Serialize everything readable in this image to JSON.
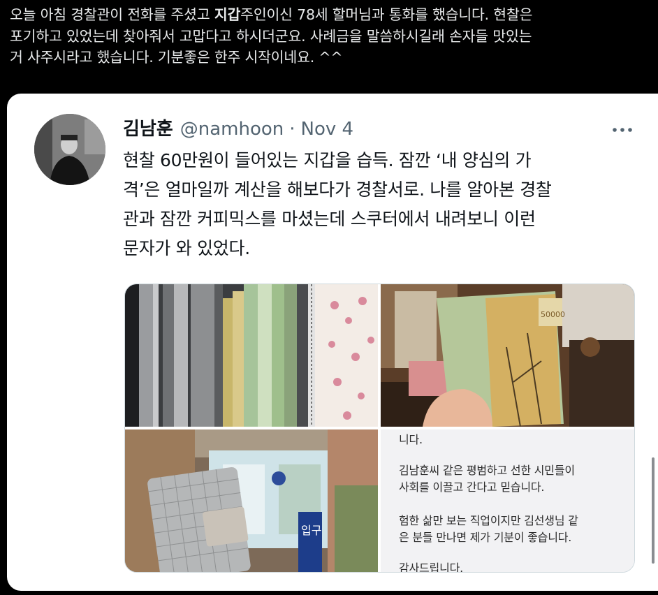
{
  "intro": {
    "line1_a": "오늘 아침 경찰관이 전화를 주셨고 ",
    "line1_bold": "지갑",
    "line1_b": "주인이신 78세 할머님과 통화를 했습니다. 현찰은",
    "line2": "포기하고 있었는데 찾아줘서 고맙다고 하시더군요. 사례금을 말씀하시길래 손자들 맛있는",
    "line3": "거 사주시라고 했습니다. 기분좋은 한주  시작이네요. ^^"
  },
  "quoted_tweet": {
    "author_name": "김남훈",
    "handle": "@namhoon",
    "separator": "·",
    "date": "Nov 4",
    "more_icon": "more-horizontal-icon",
    "body_lines": [
      "현찰 60만원이 들어있는 지갑을 습득. 잠깐 ‘내 양심의 가",
      "격’은 얼마일까 계산을 해보다가 경찰서로. 나를 알아본 경찰",
      "관과 잠깐 커피믹스를 마셨는데 스쿠터에서 내려보니 이런",
      "문자가 와 있었다."
    ]
  },
  "media": {
    "banknote_text": "50000",
    "sign_text": "입구",
    "sms_lines": [
      "니다.",
      "",
      "김남훈씨  같은 평범하고 선한 시민들이",
      "사회를 이끌고 간다고  믿습니다.",
      "",
      "험한 삶만 보는 직업이지만 김선생님 같",
      "은 분들 만나면  제가 기분이 좋습니다.",
      "",
      "감사드립니다."
    ]
  },
  "colors": {
    "background": "#000000",
    "card": "#ffffff",
    "primary_text": "#0f1419",
    "secondary_text": "#536471",
    "intro_text": "#e7e9ea"
  }
}
